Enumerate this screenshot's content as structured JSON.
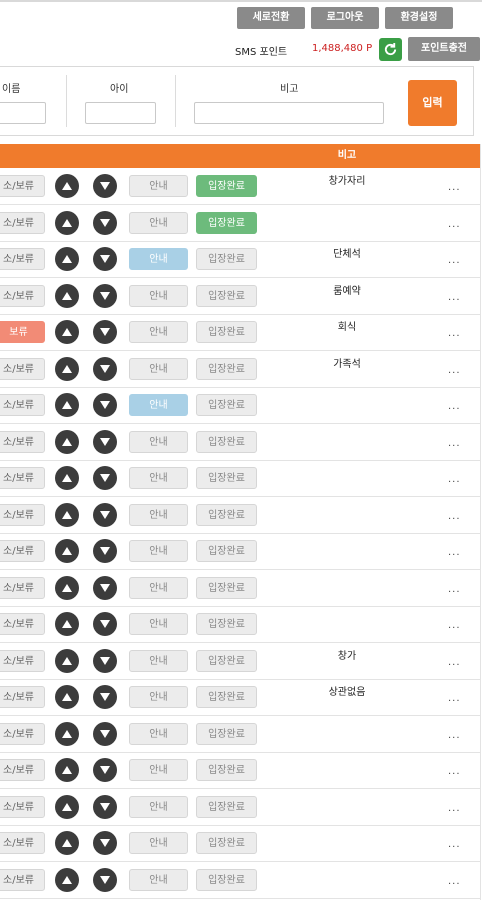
{
  "top": {
    "vertical_btn": "세로전환",
    "logout_btn": "로그아웃",
    "settings_btn": "환경설정",
    "sms_label": "SMS 포인트",
    "sms_value": "1,488,480 P",
    "charge_btn": "포인트충전"
  },
  "form": {
    "name_label": "이름",
    "child_label": "아이",
    "memo_label": "비고",
    "submit_label": "입력"
  },
  "table": {
    "header_memo": "비고",
    "rows": [
      {
        "cancel": "소/보류",
        "guide": "안내",
        "enter": "입장완료",
        "memo": "창가자리",
        "more": "...",
        "cancel_on": false,
        "guide_on": false,
        "enter_on": true
      },
      {
        "cancel": "소/보류",
        "guide": "안내",
        "enter": "입장완료",
        "memo": "",
        "more": "...",
        "cancel_on": false,
        "guide_on": false,
        "enter_on": true
      },
      {
        "cancel": "소/보류",
        "guide": "안내",
        "enter": "입장완료",
        "memo": "단체석",
        "more": "...",
        "cancel_on": false,
        "guide_on": true,
        "enter_on": false
      },
      {
        "cancel": "소/보류",
        "guide": "안내",
        "enter": "입장완료",
        "memo": "룸예약",
        "more": "...",
        "cancel_on": false,
        "guide_on": false,
        "enter_on": false
      },
      {
        "cancel": "보류",
        "guide": "안내",
        "enter": "입장완료",
        "memo": "회식",
        "more": "...",
        "cancel_on": true,
        "guide_on": false,
        "enter_on": false
      },
      {
        "cancel": "소/보류",
        "guide": "안내",
        "enter": "입장완료",
        "memo": "가족석",
        "more": "...",
        "cancel_on": false,
        "guide_on": false,
        "enter_on": false
      },
      {
        "cancel": "소/보류",
        "guide": "안내",
        "enter": "입장완료",
        "memo": "",
        "more": "...",
        "cancel_on": false,
        "guide_on": true,
        "enter_on": false
      },
      {
        "cancel": "소/보류",
        "guide": "안내",
        "enter": "입장완료",
        "memo": "",
        "more": "...",
        "cancel_on": false,
        "guide_on": false,
        "enter_on": false
      },
      {
        "cancel": "소/보류",
        "guide": "안내",
        "enter": "입장완료",
        "memo": "",
        "more": "...",
        "cancel_on": false,
        "guide_on": false,
        "enter_on": false
      },
      {
        "cancel": "소/보류",
        "guide": "안내",
        "enter": "입장완료",
        "memo": "",
        "more": "...",
        "cancel_on": false,
        "guide_on": false,
        "enter_on": false
      },
      {
        "cancel": "소/보류",
        "guide": "안내",
        "enter": "입장완료",
        "memo": "",
        "more": "...",
        "cancel_on": false,
        "guide_on": false,
        "enter_on": false
      },
      {
        "cancel": "소/보류",
        "guide": "안내",
        "enter": "입장완료",
        "memo": "",
        "more": "...",
        "cancel_on": false,
        "guide_on": false,
        "enter_on": false
      },
      {
        "cancel": "소/보류",
        "guide": "안내",
        "enter": "입장완료",
        "memo": "",
        "more": "...",
        "cancel_on": false,
        "guide_on": false,
        "enter_on": false
      },
      {
        "cancel": "소/보류",
        "guide": "안내",
        "enter": "입장완료",
        "memo": "창가",
        "more": "...",
        "cancel_on": false,
        "guide_on": false,
        "enter_on": false
      },
      {
        "cancel": "소/보류",
        "guide": "안내",
        "enter": "입장완료",
        "memo": "상관없음",
        "more": "...",
        "cancel_on": false,
        "guide_on": false,
        "enter_on": false
      },
      {
        "cancel": "소/보류",
        "guide": "안내",
        "enter": "입장완료",
        "memo": "",
        "more": "...",
        "cancel_on": false,
        "guide_on": false,
        "enter_on": false
      },
      {
        "cancel": "소/보류",
        "guide": "안내",
        "enter": "입장완료",
        "memo": "",
        "more": "...",
        "cancel_on": false,
        "guide_on": false,
        "enter_on": false
      },
      {
        "cancel": "소/보류",
        "guide": "안내",
        "enter": "입장완료",
        "memo": "",
        "more": "...",
        "cancel_on": false,
        "guide_on": false,
        "enter_on": false
      },
      {
        "cancel": "소/보류",
        "guide": "안내",
        "enter": "입장완료",
        "memo": "",
        "more": "...",
        "cancel_on": false,
        "guide_on": false,
        "enter_on": false
      },
      {
        "cancel": "소/보류",
        "guide": "안내",
        "enter": "입장완료",
        "memo": "",
        "more": "...",
        "cancel_on": false,
        "guide_on": false,
        "enter_on": false
      }
    ]
  },
  "icons": {
    "refresh": "refresh-icon",
    "up": "arrow-up-icon",
    "down": "arrow-down-icon"
  },
  "colors": {
    "accent": "#f07b2c",
    "sms_value": "#cc1f1f",
    "refresh_bg": "#3a9e46",
    "enter_active": "#6dbb7c",
    "guide_active": "#a9d0e6",
    "cancel_active": "#f28b76"
  }
}
